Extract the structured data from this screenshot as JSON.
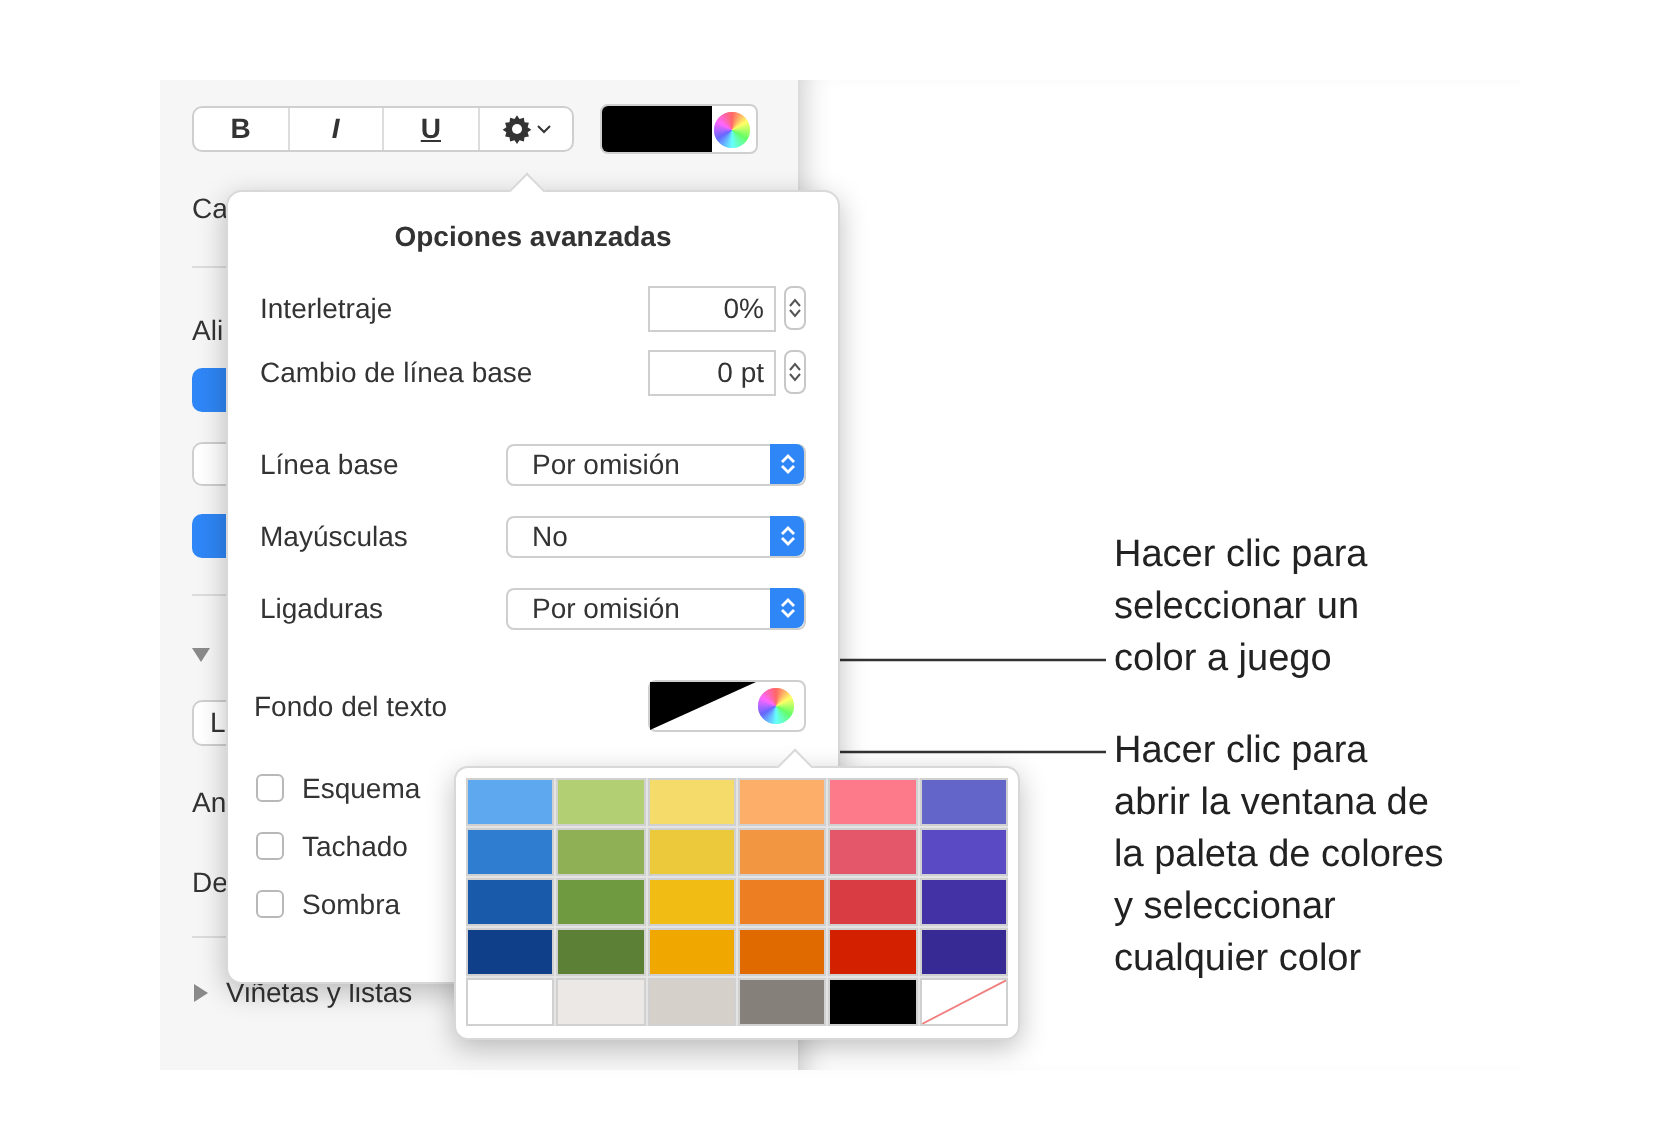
{
  "toolbar": {
    "buttons": [
      {
        "kind": "bold",
        "label": "B"
      },
      {
        "kind": "italic",
        "label": "I"
      },
      {
        "kind": "underline",
        "label": "U"
      },
      {
        "kind": "gear"
      }
    ],
    "color_well": {
      "color": "#000000"
    }
  },
  "sidebar": {
    "label_1": "Ca",
    "label_2": "Ali",
    "field_value": "L",
    "label_3": "An",
    "label_4": "De",
    "upper_section": {
      "expanded": true
    },
    "section": {
      "title": "Viñetas y listas",
      "expanded": false
    }
  },
  "advanced_popover": {
    "title": "Opciones avanzadas",
    "steppers": [
      {
        "label": "Interletraje",
        "value": "0%"
      },
      {
        "label": "Cambio de línea base",
        "value": "0 pt"
      }
    ],
    "popups": [
      {
        "label": "Línea base",
        "value": "Por omisión"
      },
      {
        "label": "Mayúsculas",
        "value": "No"
      },
      {
        "label": "Ligaduras",
        "value": "Por omisión"
      }
    ],
    "text_background": {
      "label": "Fondo del texto"
    },
    "checkboxes": [
      {
        "label": "Esquema",
        "checked": false
      },
      {
        "label": "Tachado",
        "checked": false
      },
      {
        "label": "Sombra",
        "checked": false
      }
    ]
  },
  "palette": {
    "rows": [
      {
        "swatches": [
          {
            "kind": "color",
            "color": "#5ea8f0"
          },
          {
            "kind": "color",
            "color": "#b2cf74"
          },
          {
            "kind": "color",
            "color": "#f5dc6a"
          },
          {
            "kind": "color",
            "color": "#fdae68"
          },
          {
            "kind": "color",
            "color": "#fd7a8a"
          },
          {
            "kind": "color",
            "color": "#6366c8"
          }
        ]
      },
      {
        "swatches": [
          {
            "kind": "color",
            "color": "#2f7dd0"
          },
          {
            "kind": "color",
            "color": "#90b055"
          },
          {
            "kind": "color",
            "color": "#ecc93a"
          },
          {
            "kind": "color",
            "color": "#f39642"
          },
          {
            "kind": "color",
            "color": "#e4566a"
          },
          {
            "kind": "color",
            "color": "#5a4bc5"
          }
        ]
      },
      {
        "swatches": [
          {
            "kind": "color",
            "color": "#1a5aab"
          },
          {
            "kind": "color",
            "color": "#709a40"
          },
          {
            "kind": "color",
            "color": "#f1bc14"
          },
          {
            "kind": "color",
            "color": "#ee7e22"
          },
          {
            "kind": "color",
            "color": "#d93c42"
          },
          {
            "kind": "color",
            "color": "#4232a5"
          }
        ]
      },
      {
        "swatches": [
          {
            "kind": "color",
            "color": "#103f8a"
          },
          {
            "kind": "color",
            "color": "#5b8036"
          },
          {
            "kind": "color",
            "color": "#f0a800"
          },
          {
            "kind": "color",
            "color": "#e06a00"
          },
          {
            "kind": "color",
            "color": "#d22000"
          },
          {
            "kind": "color",
            "color": "#372a95"
          }
        ]
      },
      {
        "swatches": [
          {
            "kind": "color",
            "color": "#ffffff"
          },
          {
            "kind": "color",
            "color": "#ebe8e5"
          },
          {
            "kind": "color",
            "color": "#d6d0cb"
          },
          {
            "kind": "color",
            "color": "#858079"
          },
          {
            "kind": "color",
            "color": "#000000"
          },
          {
            "kind": "none"
          }
        ]
      }
    ]
  },
  "callouts": [
    {
      "lines": [
        "Hacer clic para",
        "seleccionar un",
        "color a juego"
      ]
    },
    {
      "lines": [
        "Hacer clic para",
        "abrir la ventana de",
        "la paleta de colores",
        "y seleccionar",
        "cualquier color"
      ]
    }
  ]
}
